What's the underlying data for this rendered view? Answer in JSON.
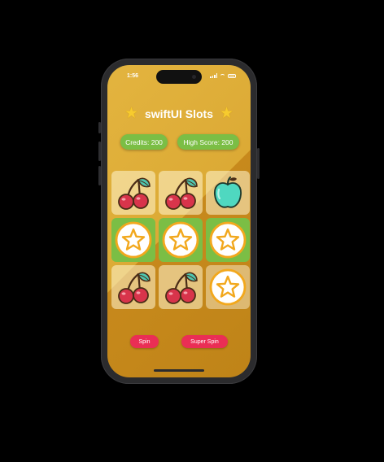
{
  "status": {
    "time": "1:56"
  },
  "header": {
    "title": "swiftUI Slots",
    "star_glyph": "★"
  },
  "stats": {
    "credits": "Credits: 200",
    "high_score": "High Score: 200"
  },
  "grid": [
    [
      "cherry",
      "cherry",
      "apple"
    ],
    [
      "star",
      "star",
      "star"
    ],
    [
      "cherry",
      "cherry",
      "star"
    ]
  ],
  "highlight_row": 1,
  "buttons": {
    "spin": "Spin",
    "super_spin": "Super Spin"
  },
  "colors": {
    "background_light": "#e3b43f",
    "background_dark": "#bf8418",
    "accent_green": "#7bbe45",
    "button_red": "#ea2e55",
    "star_yellow": "#f7cb2e"
  }
}
